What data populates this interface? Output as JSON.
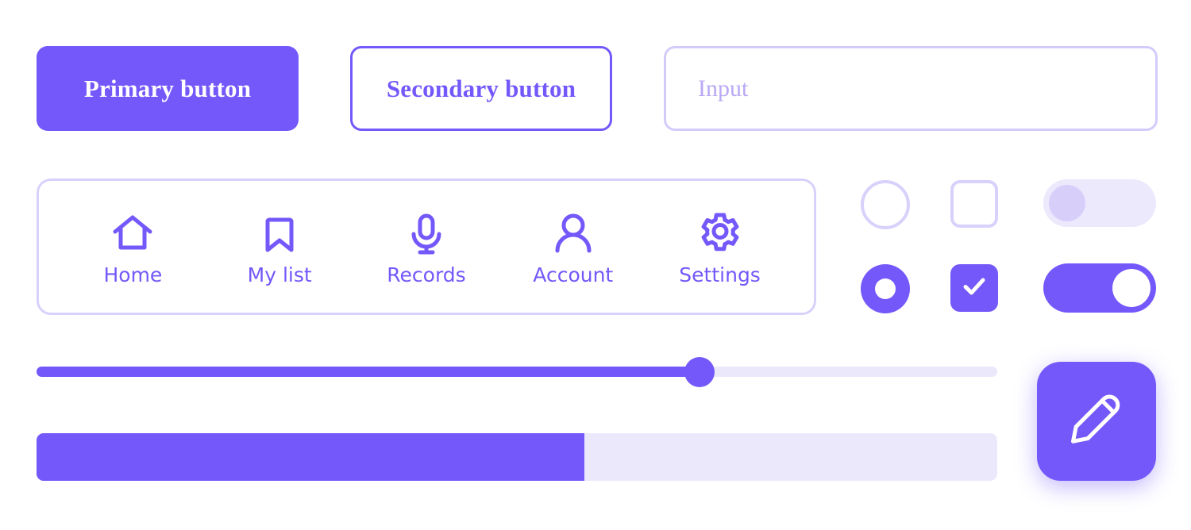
{
  "theme": {
    "primary": "#7458fa",
    "primary_light": "#d9d1fb",
    "track_light": "#ebe8fc",
    "knob_off": "#d8cefa",
    "placeholder": "#b9a8f5",
    "white": "#ffffff",
    "background": "#ffffff"
  },
  "buttons": {
    "primary_label": "Primary button",
    "secondary_label": "Secondary button"
  },
  "input": {
    "placeholder": "Input",
    "value": ""
  },
  "navbar": {
    "items": [
      {
        "label": "Home",
        "icon": "home-icon"
      },
      {
        "label": "My list",
        "icon": "bookmark-icon"
      },
      {
        "label": "Records",
        "icon": "microphone-icon"
      },
      {
        "label": "Account",
        "icon": "person-icon"
      },
      {
        "label": "Settings",
        "icon": "gear-icon"
      }
    ]
  },
  "controls": {
    "radio_off": {
      "name": "radio-unselected",
      "checked": false
    },
    "radio_on": {
      "name": "radio-selected",
      "checked": true
    },
    "checkbox_off": {
      "name": "checkbox-unchecked",
      "checked": false
    },
    "checkbox_on": {
      "name": "checkbox-checked",
      "checked": true,
      "icon": "check-icon"
    },
    "toggle_off": {
      "name": "toggle-off",
      "on": false
    },
    "toggle_on": {
      "name": "toggle-on",
      "on": true
    }
  },
  "slider": {
    "value": 69,
    "min": 0,
    "max": 100,
    "fill_percent": "69%",
    "thumb_percent": "69%"
  },
  "progress": {
    "value": 57,
    "min": 0,
    "max": 100,
    "fill_percent": "57%"
  },
  "fab": {
    "icon": "pencil-icon",
    "label": "Edit"
  }
}
